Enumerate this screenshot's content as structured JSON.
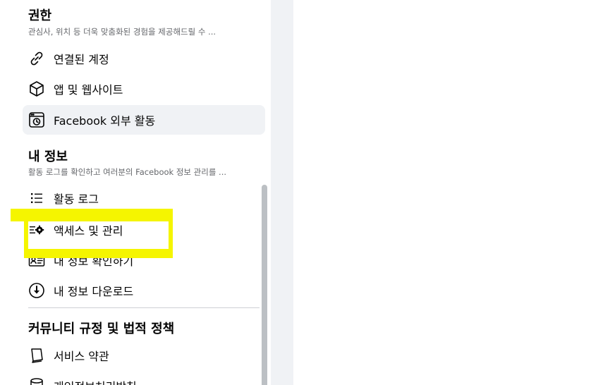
{
  "permissions": {
    "title": "권한",
    "description": "관심사, 위치 등 더욱 맞춤화된 경험을 제공해드릴 수 ...",
    "items": [
      {
        "label": "연결된 계정",
        "icon": "link-icon"
      },
      {
        "label": "앱 및 웹사이트",
        "icon": "cube-icon"
      },
      {
        "label": "Facebook 외부 활동",
        "icon": "off-facebook-activity-icon"
      }
    ]
  },
  "your_information": {
    "title": "내 정보",
    "description": "활동 로그를 확인하고 여러분의 Facebook 정보 관리를 ...",
    "items": [
      {
        "label": "활동 로그",
        "icon": "list-icon"
      },
      {
        "label": "액세스 및 관리",
        "icon": "list-gear-icon"
      },
      {
        "label": "내 정보 확인하기",
        "icon": "profile-card-icon"
      },
      {
        "label": "내 정보 다운로드",
        "icon": "download-icon"
      }
    ]
  },
  "community": {
    "title": "커뮤니티 규정 및 법적 정책",
    "items": [
      {
        "label": "서비스 약관",
        "icon": "book-icon"
      },
      {
        "label": "개인정보처리방침",
        "icon": "database-icon"
      }
    ]
  },
  "colors": {
    "highlight": "#f5f500",
    "active_bg": "#f0f2f5",
    "gutter": "#f0f2f5"
  }
}
